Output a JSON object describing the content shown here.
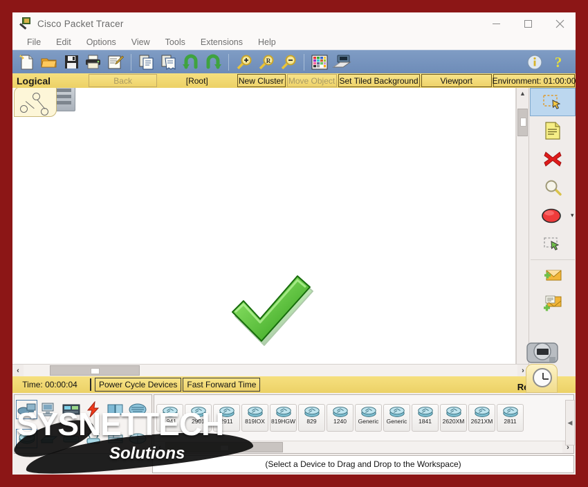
{
  "window": {
    "title": "Cisco Packet Tracer",
    "icon": "packet-tracer-icon",
    "minimize": "–",
    "maximize": "▢",
    "close": "✕"
  },
  "menu": {
    "items": [
      {
        "label": "File"
      },
      {
        "label": "Edit"
      },
      {
        "label": "Options"
      },
      {
        "label": "View"
      },
      {
        "label": "Tools"
      },
      {
        "label": "Extensions"
      },
      {
        "label": "Help"
      }
    ]
  },
  "toolbar": {
    "items": [
      {
        "name": "new-file-icon",
        "title": "New"
      },
      {
        "name": "open-folder-icon",
        "title": "Open"
      },
      {
        "name": "save-icon",
        "title": "Save"
      },
      {
        "name": "print-icon",
        "title": "Print"
      },
      {
        "name": "activity-wizard-icon",
        "title": "Activity Wizard"
      },
      {
        "name": "copy-icon",
        "title": "Copy"
      },
      {
        "name": "paste-icon",
        "title": "Paste"
      },
      {
        "name": "undo-icon",
        "title": "Undo"
      },
      {
        "name": "redo-icon",
        "title": "Redo"
      },
      {
        "name": "zoom-in-icon",
        "title": "Zoom In"
      },
      {
        "name": "zoom-reset-icon",
        "title": "Zoom Reset"
      },
      {
        "name": "zoom-out-icon",
        "title": "Zoom Out"
      },
      {
        "name": "palette-icon",
        "title": "Drawing Palette"
      },
      {
        "name": "custom-devices-icon",
        "title": "Custom Devices Dialog"
      }
    ],
    "info_icon": "info-icon",
    "help_icon": "help-icon"
  },
  "view_bar": {
    "mode_label": "Logical",
    "back": "Back",
    "root": "[Root]",
    "new_cluster": "New Cluster",
    "move_object": "Move Object",
    "set_tiled_background": "Set Tiled Background",
    "viewport": "Viewport",
    "environment": "Environment: 01:00:00"
  },
  "workspace": {
    "cluster_icon": "network-cluster-icon",
    "checkmark_icon": "green-checkmark-icon"
  },
  "tools": {
    "items": [
      {
        "name": "select-tool",
        "label": "Select",
        "selected": true
      },
      {
        "name": "place-note-tool",
        "label": "Place Note",
        "selected": false
      },
      {
        "name": "delete-tool",
        "label": "Delete",
        "selected": false
      },
      {
        "name": "inspect-tool",
        "label": "Inspect",
        "selected": false
      },
      {
        "name": "draw-shape-tool",
        "label": "Draw Shape",
        "selected": false
      },
      {
        "name": "resize-shape-tool",
        "label": "Resize Shape",
        "selected": false
      },
      {
        "name": "add-simple-pdu-tool",
        "label": "Add Simple PDU",
        "selected": false
      },
      {
        "name": "add-complex-pdu-tool",
        "label": "Add Complex PDU",
        "selected": false
      }
    ],
    "shape_dropdown": "▾"
  },
  "time_bar": {
    "time": "Time: 00:00:04",
    "power_cycle": "Power Cycle Devices",
    "fast_forward": "Fast Forward Time",
    "realtime_label": "Realtime",
    "realtime_icon": "clock-icon",
    "camera_icon": "camera-icon"
  },
  "device_categories": {
    "row1": [
      {
        "name": "network-devices-icon",
        "label": "Network Devices",
        "selected": true
      },
      {
        "name": "end-devices-icon",
        "label": "End Devices",
        "selected": false
      },
      {
        "name": "components-icon",
        "label": "Components",
        "selected": false
      },
      {
        "name": "connections-icon",
        "label": "Connections",
        "selected": false
      },
      {
        "name": "miscellaneous-icon",
        "label": "Miscellaneous",
        "selected": false
      },
      {
        "name": "multiuser-connection-icon",
        "label": "Multiuser Connection",
        "selected": false
      }
    ],
    "row2": [
      {
        "name": "routers-icon",
        "label": "Routers",
        "selected": true
      },
      {
        "name": "switches-icon",
        "label": "Switches",
        "selected": false
      },
      {
        "name": "hubs-icon",
        "label": "Hubs",
        "selected": false
      },
      {
        "name": "wireless-devices-icon",
        "label": "Wireless Devices",
        "selected": false
      },
      {
        "name": "security-icon",
        "label": "Security",
        "selected": false
      },
      {
        "name": "wan-emulation-icon",
        "label": "WAN Emulation",
        "selected": false
      }
    ]
  },
  "device_palette": {
    "devices": [
      {
        "label": "1941",
        "icon": "router-icon"
      },
      {
        "label": "2901",
        "icon": "router-icon"
      },
      {
        "label": "2911",
        "icon": "router-icon"
      },
      {
        "label": "819IOX",
        "icon": "router-icon"
      },
      {
        "label": "819HGW",
        "icon": "router-icon"
      },
      {
        "label": "829",
        "icon": "router-icon"
      },
      {
        "label": "1240",
        "icon": "router-icon"
      },
      {
        "label": "Generic",
        "icon": "router-icon"
      },
      {
        "label": "Generic",
        "icon": "router-icon"
      },
      {
        "label": "1841",
        "icon": "router-icon"
      },
      {
        "label": "2620XM",
        "icon": "router-icon"
      },
      {
        "label": "2621XM",
        "icon": "router-icon"
      },
      {
        "label": "2811",
        "icon": "router-icon"
      }
    ]
  },
  "status_bar": {
    "hint": "(Select a Device to Drag and Drop to the Workspace)"
  },
  "watermark": {
    "line1": "SYSNETTECH",
    "line2": "Solutions"
  },
  "colors": {
    "desktop": "#8c1616",
    "toolbar_blue": "#7f9cc4",
    "yellow_bar": "#f6e07f",
    "selection_blue": "#bcd7ef",
    "checkmark_green": "#2fa72f"
  }
}
